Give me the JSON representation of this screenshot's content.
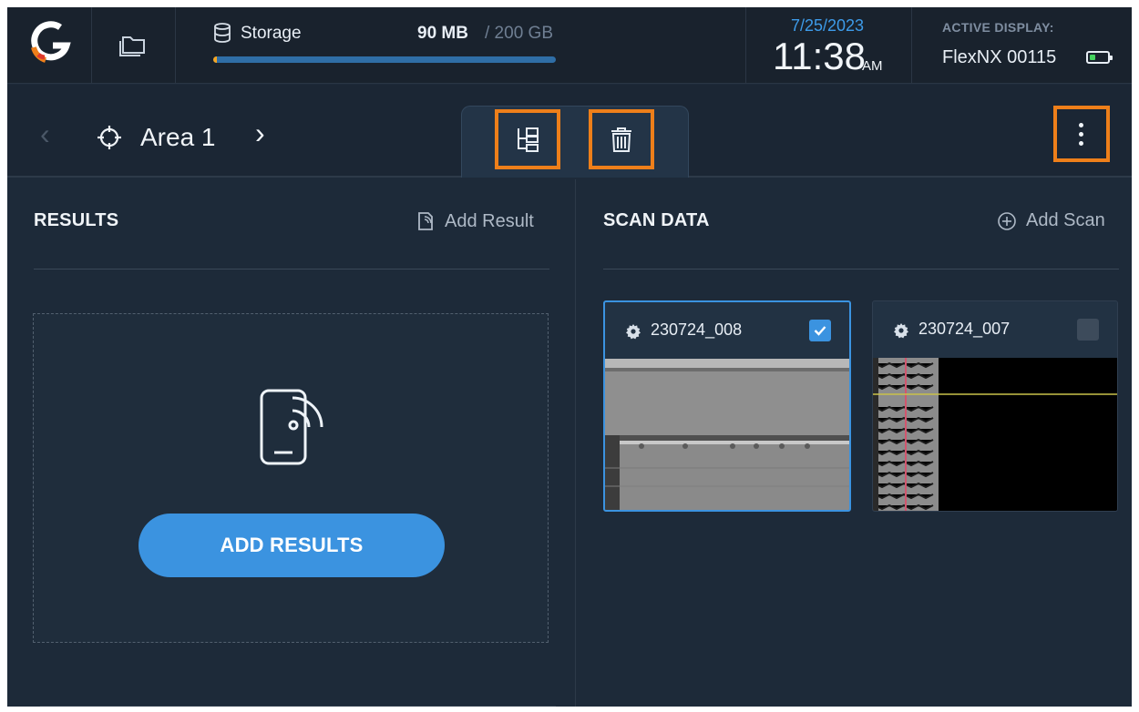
{
  "topbar": {
    "storage": {
      "label": "Storage",
      "used": "90 MB",
      "total": "/ 200 GB",
      "fill_fraction": 0.01
    },
    "date": "7/25/2023",
    "time": "11:38",
    "ampm": "AM",
    "active_display_label": "ACTIVE DISPLAY:",
    "active_display_name": "FlexNX 00115",
    "battery_color": "#44d35e"
  },
  "nav": {
    "prev_glyph": "‹",
    "title": "Area 1",
    "next_glyph": "›"
  },
  "results": {
    "header": "RESULTS",
    "action_label": "Add Result",
    "button_label": "ADD RESULTS"
  },
  "scan_data": {
    "header": "SCAN DATA",
    "action_label": "Add Scan",
    "scans": [
      {
        "name": "230724_008",
        "checked": true
      },
      {
        "name": "230724_007",
        "checked": false
      }
    ]
  },
  "colors": {
    "accent": "#3b93e0",
    "highlight": "#ee7f1a",
    "background": "#1d2a39"
  },
  "icons": [
    "logo-icon",
    "folder-icon",
    "database-icon",
    "crosshair-icon",
    "tree-icon",
    "trash-icon",
    "more-icon",
    "add-result-icon",
    "plus-circle-icon",
    "phone-signal-icon",
    "gear-icon",
    "checkmark-icon",
    "battery-icon"
  ]
}
